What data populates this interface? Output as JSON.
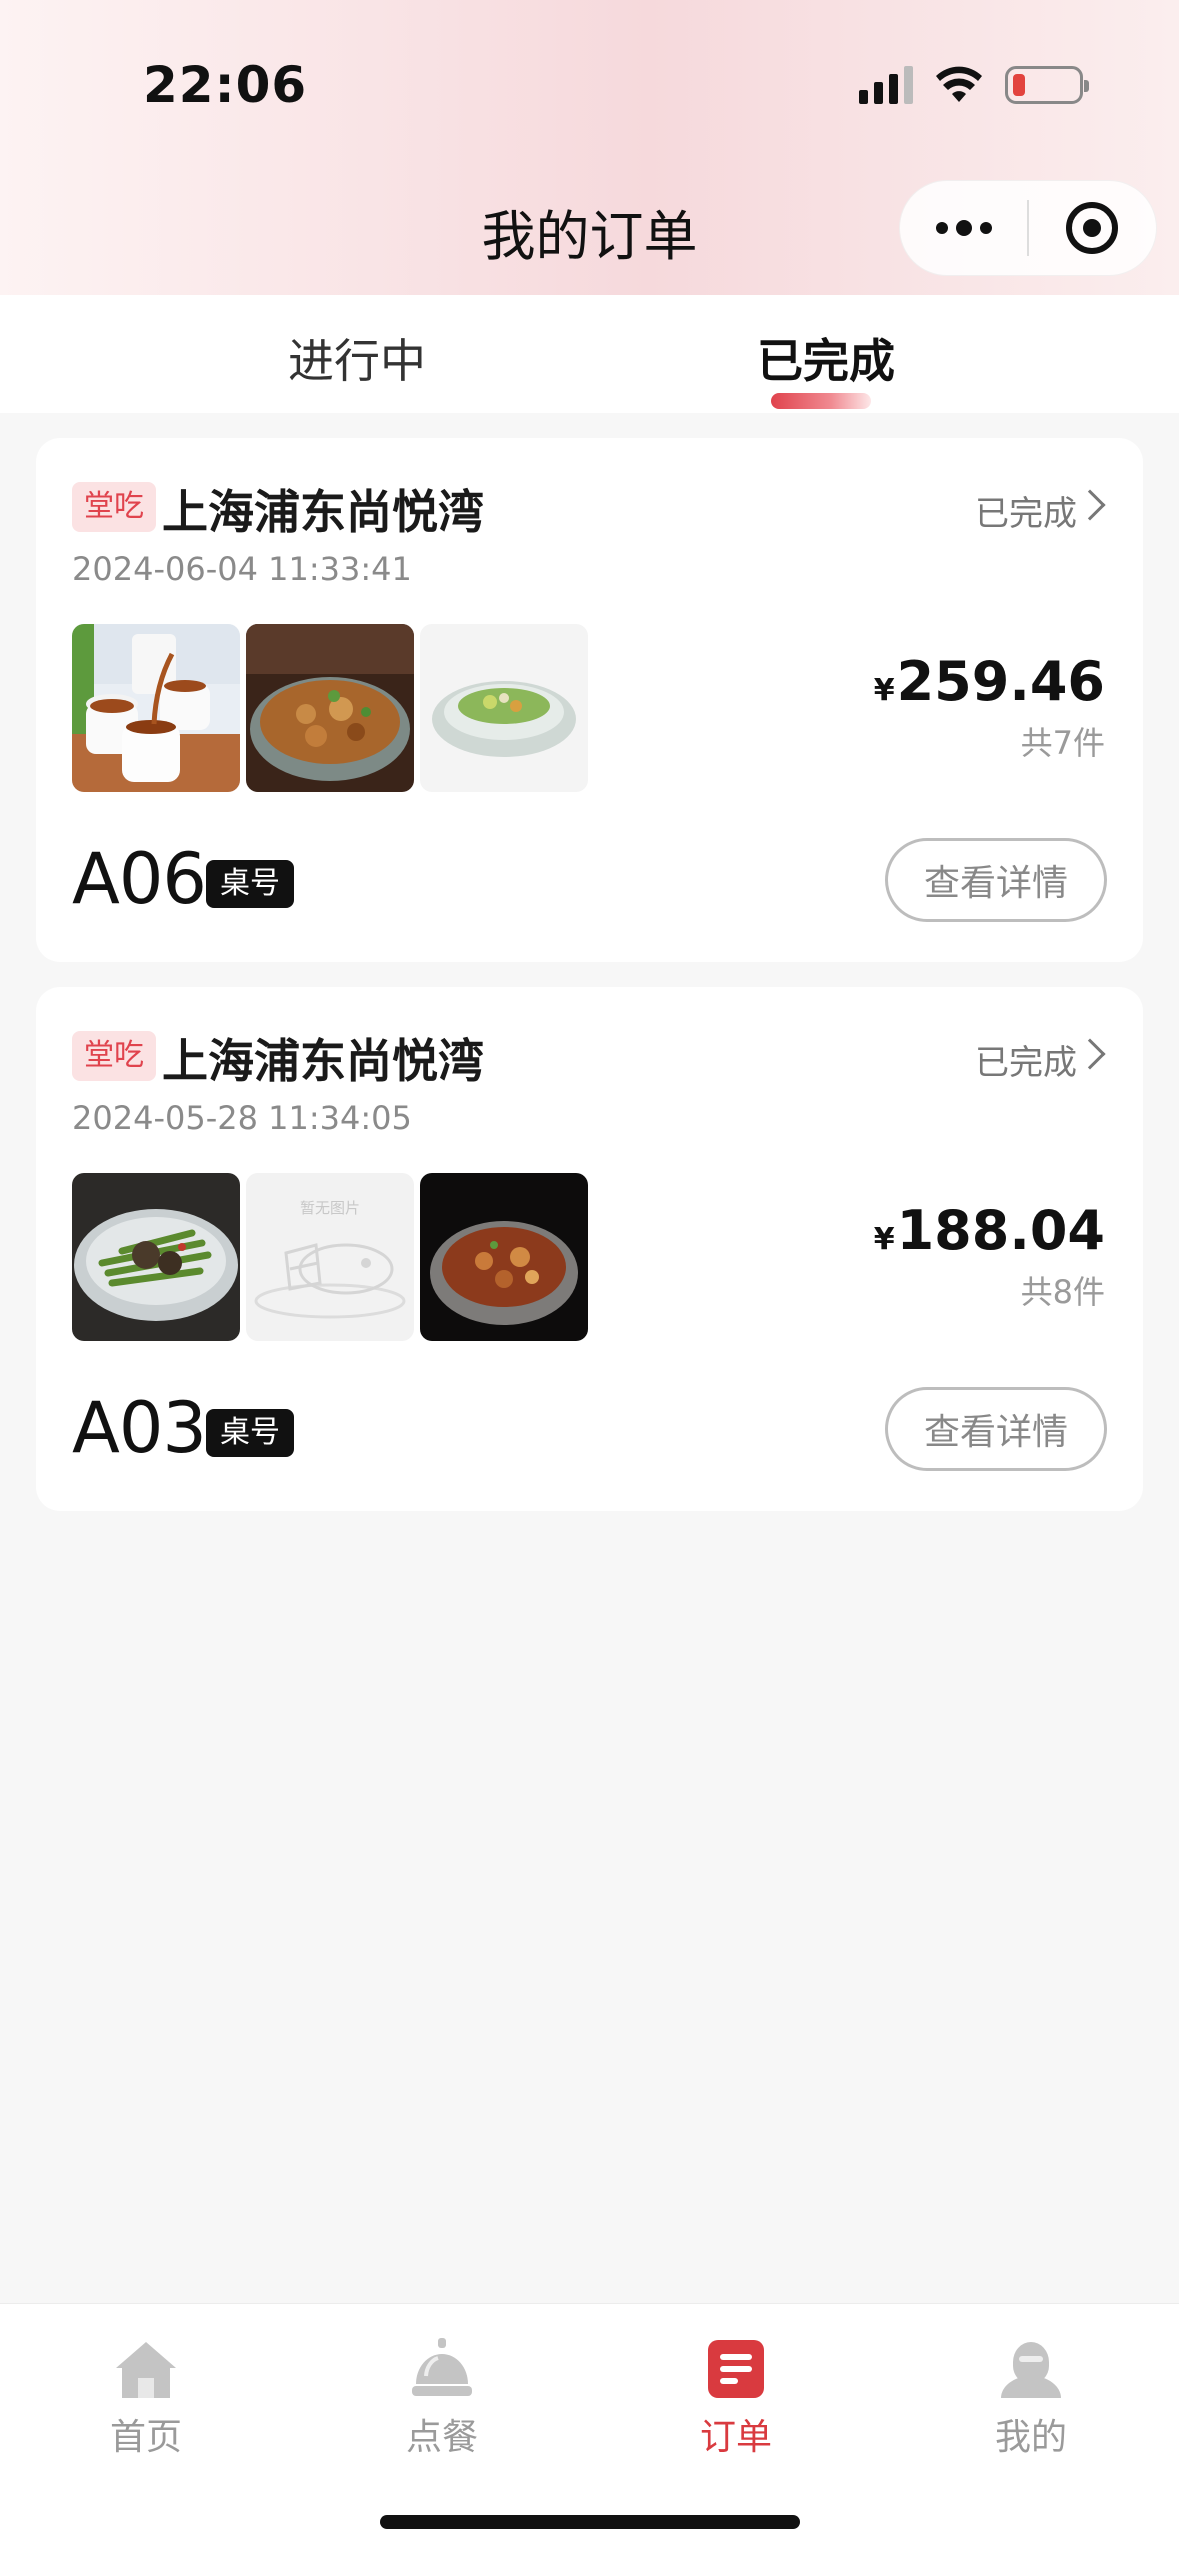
{
  "status_bar": {
    "time": "22:06"
  },
  "nav": {
    "title": "我的订单"
  },
  "tabs": [
    {
      "label": "进行中",
      "active": false
    },
    {
      "label": "已完成",
      "active": true
    }
  ],
  "orders": [
    {
      "tag": "堂吃",
      "store": "上海浦东尚悦湾",
      "status": "已完成",
      "time": "2024-06-04 11:33:41",
      "currency": "¥",
      "price": "259.46",
      "count": "共7件",
      "table_no": "A06",
      "table_label": "桌号",
      "detail_label": "查看详情",
      "thumbs": [
        "tea-image",
        "stir-fry-image",
        "vegetable-dish-image"
      ]
    },
    {
      "tag": "堂吃",
      "store": "上海浦东尚悦湾",
      "status": "已完成",
      "time": "2024-05-28 11:34:05",
      "currency": "¥",
      "price": "188.04",
      "count": "共8件",
      "table_no": "A03",
      "table_label": "桌号",
      "detail_label": "查看详情",
      "thumbs": [
        "green-beans-image",
        "no-image-placeholder",
        "braised-dish-image"
      ],
      "placeholder_text": "暂无图片"
    }
  ],
  "tabbar": [
    {
      "label": "首页",
      "icon": "home-icon",
      "active": false
    },
    {
      "label": "点餐",
      "icon": "service-bell-icon",
      "active": false
    },
    {
      "label": "订单",
      "icon": "order-list-icon",
      "active": true
    },
    {
      "label": "我的",
      "icon": "user-icon",
      "active": false
    }
  ],
  "colors": {
    "accent": "#d93a3f",
    "tag_bg": "#fbe2e3"
  }
}
